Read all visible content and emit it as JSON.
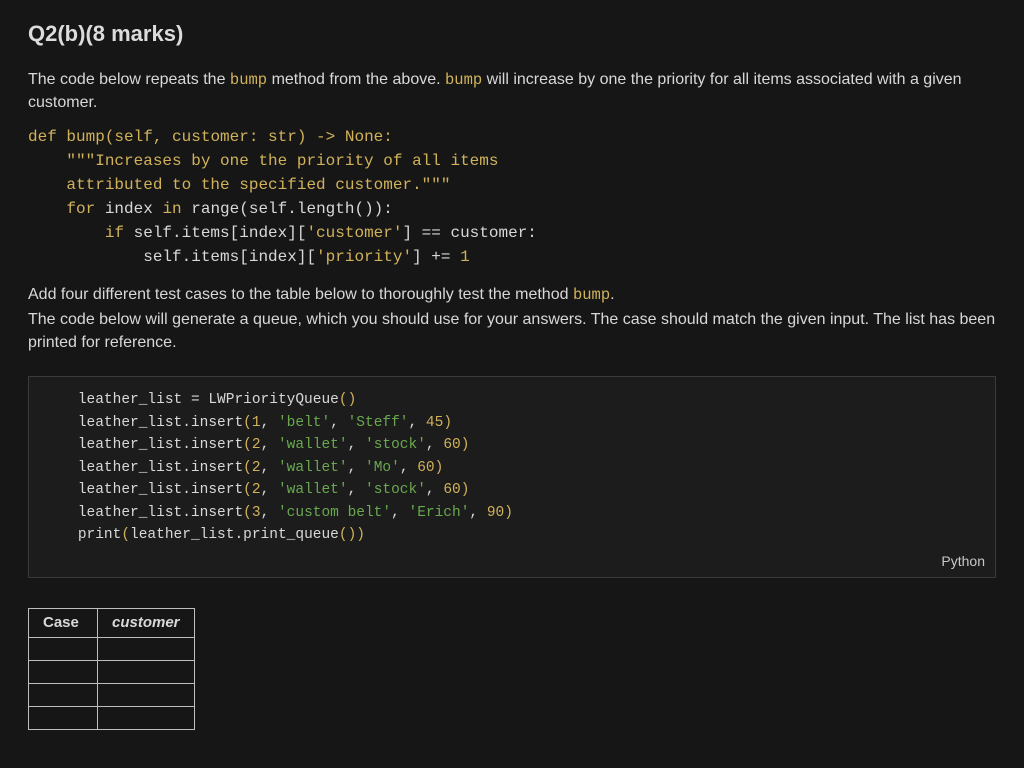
{
  "heading": "Q2(b)(8 marks)",
  "para1_pre": "The code below repeats the ",
  "para1_kw1": "bump",
  "para1_mid": " method from the above. ",
  "para1_kw2": "bump",
  "para1_post": " will increase by one the priority for all items associated with a given customer.",
  "bump_code": {
    "l1a": "def",
    "l1b": " bump(self, customer: str) -> None:",
    "l2": "    \"\"\"Increases by one the priority of all items",
    "l3": "    attributed to the specified customer.\"\"\"",
    "l4a": "    for",
    "l4b": " index ",
    "l4c": "in",
    "l4d": " range(self.length()):",
    "l5a": "        if",
    "l5b": " self.items[index][",
    "l5c": "'customer'",
    "l5d": "] == customer:",
    "l6a": "            self.items[index][",
    "l6b": "'priority'",
    "l6c": "] += ",
    "l6d": "1"
  },
  "para2_pre": "Add four different test cases to the table below to thoroughly test the method ",
  "para2_kw": "bump",
  "para2_post": ".",
  "para3": "The code below will generate a queue, which you should use for your answers. The case should match the given input. The list has been printed for reference.",
  "setup_code": {
    "ind": "    ",
    "l1": {
      "a": "leather_list ",
      "b": "=",
      "c": " LWPriorityQueue",
      "open": "(",
      "close": ")"
    },
    "l2": {
      "a": "leather_list",
      "b": ".insert",
      "open": "(",
      "p1": "1",
      "c1": ", ",
      "s1": "'belt'",
      "c2": ", ",
      "s2": "'Steff'",
      "c3": ", ",
      "p2": "45",
      "close": ")"
    },
    "l3": {
      "a": "leather_list",
      "b": ".insert",
      "open": "(",
      "p1": "2",
      "c1": ", ",
      "s1": "'wallet'",
      "c2": ", ",
      "s2": "'stock'",
      "c3": ", ",
      "p2": "60",
      "close": ")"
    },
    "l4": {
      "a": "leather_list",
      "b": ".insert",
      "open": "(",
      "p1": "2",
      "c1": ", ",
      "s1": "'wallet'",
      "c2": ", ",
      "s2": "'Mo'",
      "c3": ", ",
      "p2": "60",
      "close": ")"
    },
    "l5": {
      "a": "leather_list",
      "b": ".insert",
      "open": "(",
      "p1": "2",
      "c1": ", ",
      "s1": "'wallet'",
      "c2": ", ",
      "s2": "'stock'",
      "c3": ", ",
      "p2": "60",
      "close": ")"
    },
    "l6": {
      "a": "leather_list",
      "b": ".insert",
      "open": "(",
      "p1": "3",
      "c1": ", ",
      "s1": "'custom belt'",
      "c2": ", ",
      "s2": "'Erich'",
      "c3": ", ",
      "p2": "90",
      "close": ")"
    },
    "l7": {
      "a": "print",
      "open": "(",
      "b": "leather_list",
      "c": ".print_queue",
      "open2": "(",
      "close2": ")",
      "close": ")"
    }
  },
  "code_box_label": "Python",
  "table": {
    "h1": "Case",
    "h2": "customer"
  }
}
